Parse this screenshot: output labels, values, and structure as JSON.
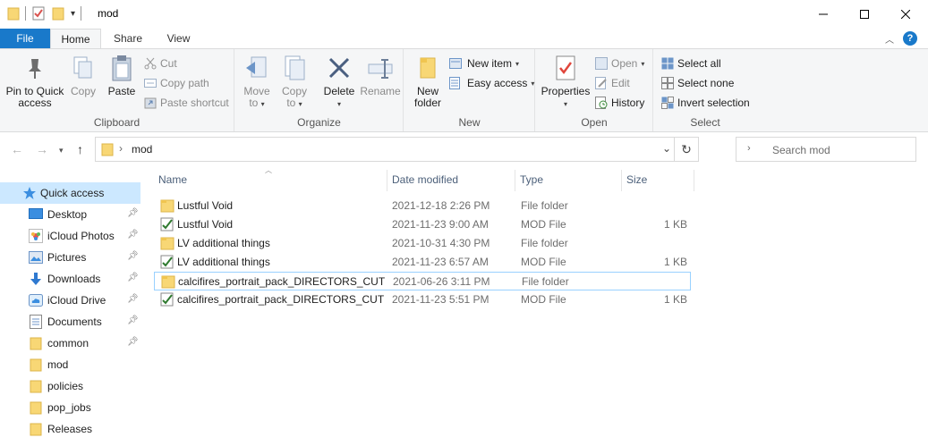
{
  "window": {
    "title": "mod",
    "controls": [
      "minimize-icon",
      "maximize-icon",
      "close-icon"
    ]
  },
  "ribbon_tabs": [
    {
      "label": "File"
    },
    {
      "label": "Home"
    },
    {
      "label": "Share"
    },
    {
      "label": "View"
    }
  ],
  "ribbon": {
    "clipboard": {
      "label": "Clipboard",
      "pin": "Pin to Quick access",
      "pin_line1": "Pin to Quick",
      "pin_line2": "access",
      "copy": "Copy",
      "paste": "Paste",
      "cut": "Cut",
      "copy_path": "Copy path",
      "paste_shortcut": "Paste shortcut"
    },
    "organize": {
      "label": "Organize",
      "move_to_1": "Move",
      "move_to_2": "to",
      "copy_to_1": "Copy",
      "copy_to_2": "to",
      "delete": "Delete",
      "rename": "Rename"
    },
    "new": {
      "label": "New",
      "new_folder_1": "New",
      "new_folder_2": "folder",
      "new_item": "New item",
      "easy_access": "Easy access"
    },
    "open": {
      "label": "Open",
      "properties": "Properties",
      "open": "Open",
      "edit": "Edit",
      "history": "History"
    },
    "select": {
      "label": "Select",
      "select_all": "Select all",
      "select_none": "Select none",
      "invert_selection": "Invert selection"
    }
  },
  "address": {
    "path": "mod",
    "search_placeholder": "Search mod"
  },
  "nav_pane": {
    "items": [
      {
        "label": "Quick access",
        "icon": "star-icon",
        "pinned": false
      },
      {
        "label": "Desktop",
        "icon": "desktop-icon",
        "pinned": true
      },
      {
        "label": "iCloud Photos",
        "icon": "photos-icon",
        "pinned": true
      },
      {
        "label": "Pictures",
        "icon": "pictures-icon",
        "pinned": true
      },
      {
        "label": "Downloads",
        "icon": "download-icon",
        "pinned": true
      },
      {
        "label": "iCloud Drive",
        "icon": "cloud-icon",
        "pinned": true
      },
      {
        "label": "Documents",
        "icon": "documents-icon",
        "pinned": true
      },
      {
        "label": "common",
        "icon": "folder-icon",
        "pinned": true
      },
      {
        "label": "mod",
        "icon": "folder-icon",
        "pinned": false
      },
      {
        "label": "policies",
        "icon": "folder-icon",
        "pinned": false
      },
      {
        "label": "pop_jobs",
        "icon": "folder-icon",
        "pinned": false
      },
      {
        "label": "Releases",
        "icon": "folder-icon",
        "pinned": false
      }
    ]
  },
  "columns": {
    "name": "Name",
    "date": "Date modified",
    "type": "Type",
    "size": "Size"
  },
  "files": [
    {
      "name": "Lustful Void",
      "date": "2021-12-18 2:26 PM",
      "type": "File folder",
      "size": "",
      "icon": "folder-icon"
    },
    {
      "name": "Lustful Void",
      "date": "2021-11-23 9:00 AM",
      "type": "MOD File",
      "size": "1 KB",
      "icon": "mod-file-icon"
    },
    {
      "name": "LV additional things",
      "date": "2021-10-31 4:30 PM",
      "type": "File folder",
      "size": "",
      "icon": "folder-icon"
    },
    {
      "name": "LV additional things",
      "date": "2021-11-23 6:57 AM",
      "type": "MOD File",
      "size": "1 KB",
      "icon": "mod-file-icon"
    },
    {
      "name": "calcifires_portrait_pack_DIRECTORS_CUT",
      "date": "2021-06-26 3:11 PM",
      "type": "File folder",
      "size": "",
      "icon": "folder-icon"
    },
    {
      "name": "calcifires_portrait_pack_DIRECTORS_CUT",
      "date": "2021-11-23 5:51 PM",
      "type": "MOD File",
      "size": "1 KB",
      "icon": "mod-file-icon"
    }
  ]
}
